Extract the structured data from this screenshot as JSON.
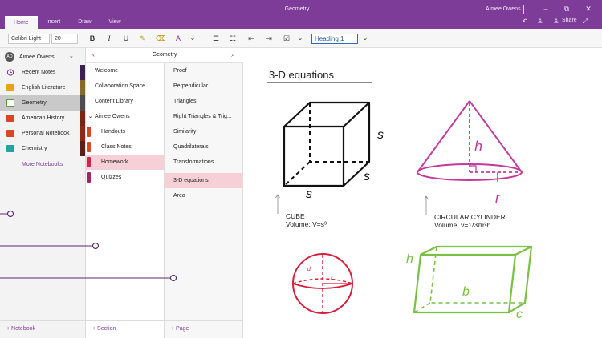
{
  "window": {
    "title": "Geometry",
    "user": "Aimee Owens",
    "controls": {
      "minimize": "–",
      "restore": "⧉",
      "close": "✕"
    }
  },
  "ribbon_tabs": [
    {
      "label": "Home",
      "active": true
    },
    {
      "label": "Insert",
      "active": false
    },
    {
      "label": "Draw",
      "active": false
    },
    {
      "label": "View",
      "active": false
    }
  ],
  "title_right": {
    "undo": "↶",
    "person": "♙",
    "share_icon": "♙",
    "share_label": "Share",
    "expand": "⤢"
  },
  "ribbon": {
    "font_name": "Calibri Light",
    "font_size": "20",
    "bold": "B",
    "italic": "I",
    "underline": "U",
    "highlight": "✎",
    "eraser": "⌫",
    "font_color": "A",
    "more_chevron": "⌄",
    "bullets": "☰",
    "numbering": "☷",
    "outdent": "⇤",
    "indent": "⇥",
    "todo_checkbox": "☑",
    "todo_chevron": "⌄",
    "style": "Heading 1",
    "style_chevron": "⌄"
  },
  "account": {
    "initials": "AO",
    "name": "Aimee Owens",
    "chevron": "⌄"
  },
  "notebooks": [
    {
      "label": "Recent Notes",
      "icon": "clock-icon",
      "color": "#7d3c97",
      "active": false
    },
    {
      "label": "English Literature",
      "icon": "notebook-icon",
      "color": "#e8a317",
      "active": false
    },
    {
      "label": "Geometry",
      "icon": "notebook-icon",
      "color": "#5c9c3b",
      "active": true
    },
    {
      "label": "American History",
      "icon": "notebook-icon",
      "color": "#d9472b",
      "active": false
    },
    {
      "label": "Personal Notebook",
      "icon": "notebook-icon",
      "color": "#d9472b",
      "active": false
    },
    {
      "label": "Chemistry",
      "icon": "notebook-icon",
      "color": "#23a4a0",
      "active": false
    }
  ],
  "more_notebooks": "More Notebooks",
  "section_header": {
    "back": "‹",
    "title": "Geometry",
    "search": "⌕"
  },
  "sections": [
    {
      "label": "Welcome",
      "indent": false,
      "active": false,
      "tab_color": ""
    },
    {
      "label": "Collaboration Space",
      "indent": false,
      "active": false,
      "tab_color": ""
    },
    {
      "label": "Content Library",
      "indent": false,
      "active": false,
      "tab_color": ""
    },
    {
      "label": "Aimee Owens",
      "indent": false,
      "active": false,
      "tab_color": "",
      "group": true,
      "chevron": "⌄"
    },
    {
      "label": "Handouts",
      "indent": true,
      "active": false,
      "tab_color": "#d9472b"
    },
    {
      "label": "Class Notes",
      "indent": true,
      "active": false,
      "tab_color": "#d9472b"
    },
    {
      "label": "Homework",
      "indent": true,
      "active": true,
      "tab_color": "#c72a4a"
    },
    {
      "label": "Quizzes",
      "indent": true,
      "active": false,
      "tab_color": "#a3236d"
    }
  ],
  "pages": [
    {
      "label": "Proof",
      "active": false
    },
    {
      "label": "Perpendicular",
      "active": false
    },
    {
      "label": "Triangles",
      "active": false
    },
    {
      "label": "Right Triangles & Trig...",
      "active": false
    },
    {
      "label": "Similarity",
      "active": false
    },
    {
      "label": "Quadrilaterals",
      "active": false
    },
    {
      "label": "Transformations",
      "active": false
    },
    {
      "label": "3-D equations",
      "active": true
    },
    {
      "label": "Area",
      "active": false
    }
  ],
  "footers": {
    "notebook": "+ Notebook",
    "section": "+ Section",
    "page": "+ Page"
  },
  "page": {
    "title": "3-D equations",
    "cube": {
      "caption_name": "CUBE",
      "caption_formula": "Volume: V=s³",
      "label": "s"
    },
    "cone": {
      "caption_name": "CIRCULAR CYLINDER",
      "caption_formula": "Volume: v=1/3πr²h",
      "height": "h",
      "radius": "r"
    },
    "sphere": {
      "diameter": "d",
      "radius": "r"
    },
    "prism": {
      "height": "h",
      "base": "b",
      "depth": "c"
    }
  },
  "colors": {
    "brand": "#7d3c97",
    "cone": "#c5399d",
    "sphere": "#d91e3a",
    "prism": "#7ac143",
    "selected": "#f6d0d6"
  }
}
